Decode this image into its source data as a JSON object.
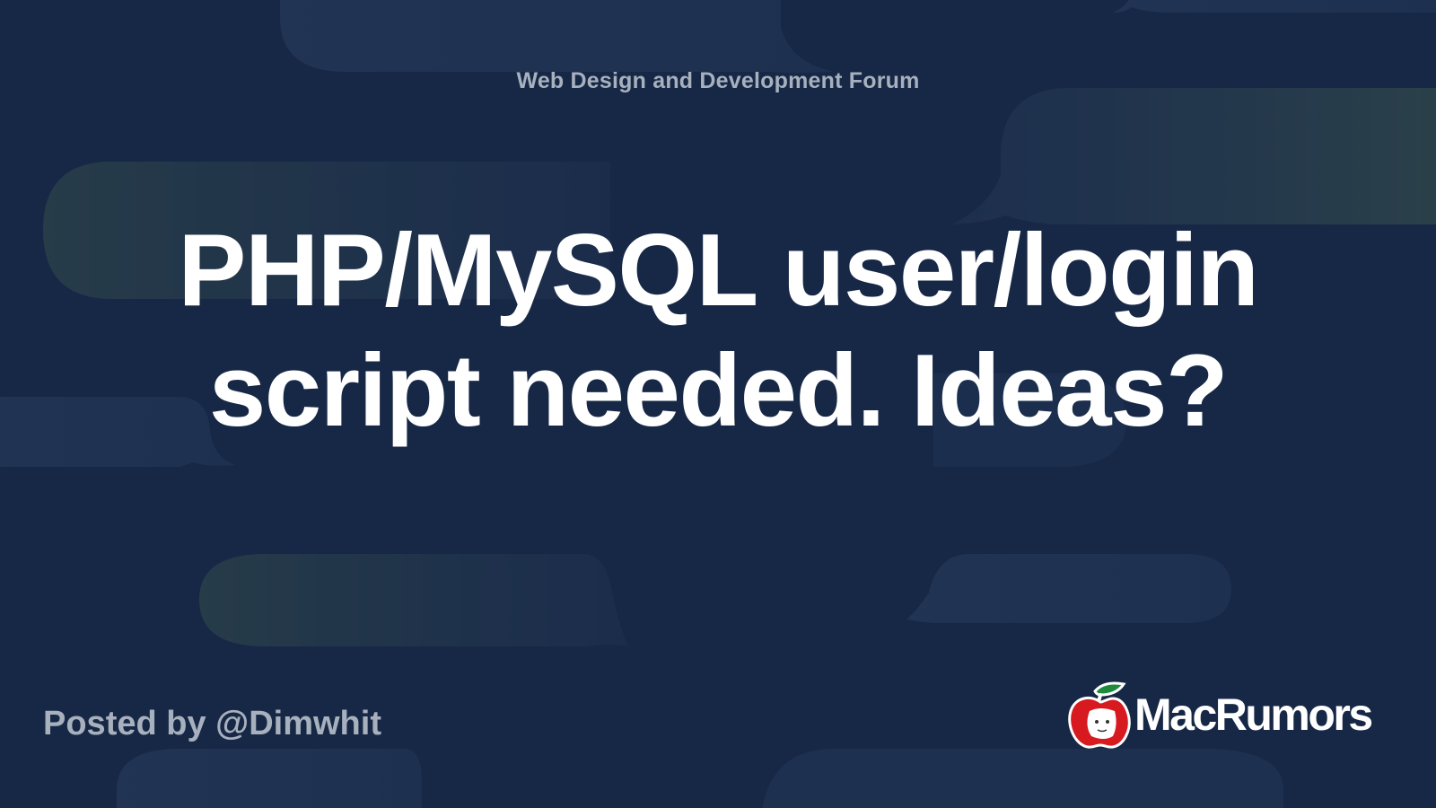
{
  "forum": {
    "name": "Web Design and Development Forum"
  },
  "thread": {
    "title": "PHP/MySQL user/login script needed. Ideas?"
  },
  "author": {
    "posted_by": "Posted by @Dimwhit"
  },
  "brand": {
    "name": "MacRumors",
    "logo_icon": "macrumors-apple-icon"
  },
  "colors": {
    "background": "#172846",
    "bubble": "#223555",
    "bubble_green": "#2a4048",
    "muted_text": "#a7b0bd",
    "title_text": "#ffffff",
    "logo_red": "#d71920",
    "logo_green": "#1d8a3c"
  }
}
